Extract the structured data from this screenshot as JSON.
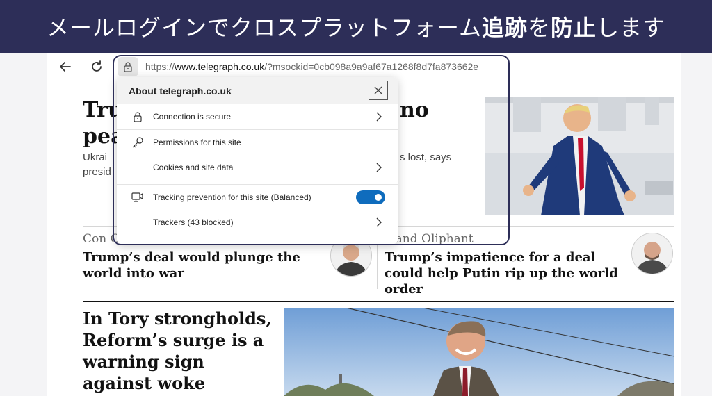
{
  "banner": {
    "part1": "メールログインでクロスプラットフォーム",
    "bold1": "追跡",
    "part2": "を",
    "bold2": "防止",
    "part3": "します"
  },
  "browser": {
    "url_prefix": "https://",
    "url_domain": "www.telegraph.co.uk",
    "url_path": "/?msockid=0cb098a9a9af67a1268f8d7fa873662e"
  },
  "popup": {
    "title": "About telegraph.co.uk",
    "connection": "Connection is secure",
    "permissions": "Permissions for this site",
    "cookies": "Cookies and site data",
    "tracking": "Tracking prevention for this site (Balanced)",
    "trackers": "Trackers (43 blocked)"
  },
  "article": {
    "main_left_1": "Tru",
    "main_left_2": "pea",
    "main_right": "no",
    "sub_left_1": "Ukrai",
    "sub_left_2": "presid",
    "sub_right": "s lost, says",
    "author_left": "Con C",
    "author_right": "oland Oliphant",
    "card1_title": "Trump’s deal would plunge the world into war",
    "card2_title": "Trump’s impatience for a deal could help Putin rip up the world order",
    "story_title": "In Tory strongholds, Reform’s surge is a warning sign against woke"
  }
}
